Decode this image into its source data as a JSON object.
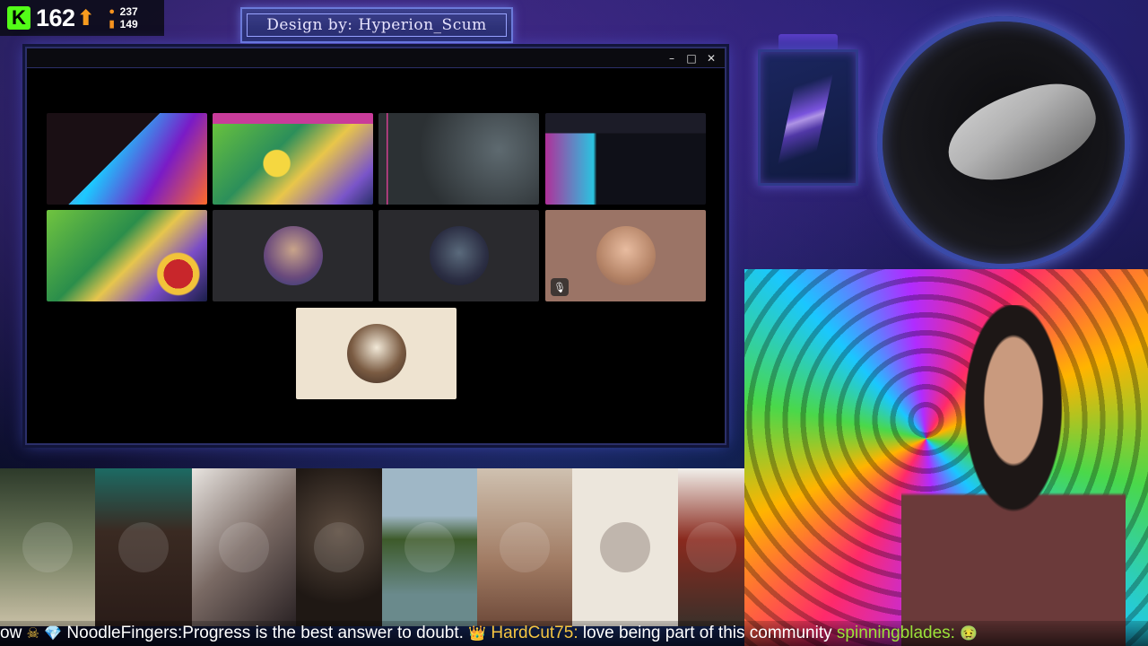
{
  "counter": {
    "value": "162",
    "stat_top": "237",
    "stat_bottom": "149",
    "colors": {
      "kick_green": "#53fc18",
      "arrow": "#f79b1e"
    }
  },
  "banner": {
    "text": "Design by: Hyperion_Scum"
  },
  "window": {
    "controls": {
      "minimize": "–",
      "maximize": "□",
      "close": "✕"
    },
    "tiles": [
      {
        "type": "screen",
        "icon": "stream-screen"
      },
      {
        "type": "screen",
        "icon": "game-board-screen"
      },
      {
        "type": "screen",
        "icon": "game-board-screen"
      },
      {
        "type": "screen",
        "icon": "video-call-screen"
      },
      {
        "type": "screen",
        "icon": "game-board-screen"
      },
      {
        "type": "avatar",
        "icon": "bird-avatar"
      },
      {
        "type": "avatar",
        "icon": "warrior-avatar"
      },
      {
        "type": "avatar",
        "icon": "muscle-man-avatar",
        "muted": true
      },
      {
        "type": "avatar",
        "icon": "bearded-gamer-avatar"
      }
    ]
  },
  "ticker": {
    "prefix": "ow ",
    "badge1": "☠",
    "badge2": "💎",
    "user1": "NoodleFingers",
    "msg1": "Progress is the best answer to doubt.",
    "crown": "👑",
    "user2": "HardCut75",
    "msg2": "love being part of this community",
    "user3": "spinningblades",
    "end_emoji": "🤢",
    "sep": ":"
  }
}
